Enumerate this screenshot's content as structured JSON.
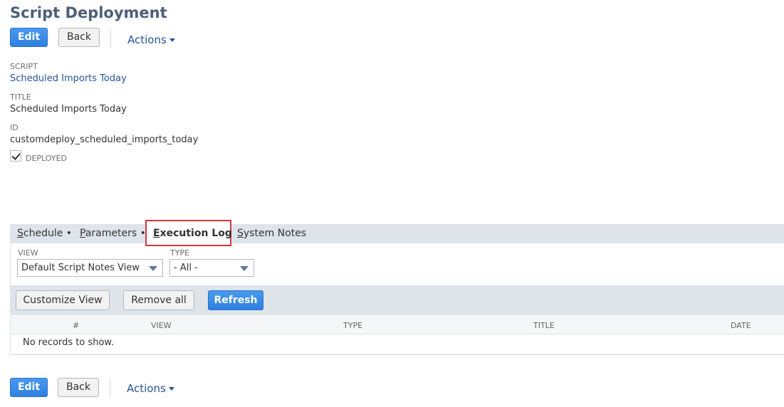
{
  "page": {
    "title": "Script Deployment"
  },
  "toolbar": {
    "edit_label": "Edit",
    "back_label": "Back",
    "actions_label": "Actions"
  },
  "fields": {
    "script_label": "Script",
    "script_value": "Scheduled Imports Today",
    "title_label": "Title",
    "title_value": "Scheduled Imports Today",
    "id_label": "ID",
    "id_value": "customdeploy_scheduled_imports_today",
    "deployed_label": "Deployed",
    "deployed_checked": true
  },
  "tabs": [
    {
      "first": "S",
      "rest": "chedule",
      "dot": " •"
    },
    {
      "first": "P",
      "rest": "arameters",
      "dot": " •"
    },
    {
      "first": "E",
      "rest": "xecution Log",
      "dot": ""
    },
    {
      "first": "S",
      "rest": "ystem Notes",
      "dot": ""
    }
  ],
  "active_tab": "Execution Log",
  "filters": {
    "view_label": "View",
    "view_value": "Default Script Notes View",
    "type_label": "Type",
    "type_value": "- All -"
  },
  "list_toolbar": {
    "customize_label": "Customize View",
    "remove_label": "Remove all",
    "refresh_label": "Refresh"
  },
  "table": {
    "columns": [
      "#",
      "View",
      "Type",
      "Title",
      "Date"
    ],
    "empty_message": "No records to show."
  },
  "colors": {
    "primary_button": "#3a8ee8",
    "link": "#255599",
    "title": "#4d5f79",
    "tab_bar": "#dfe4eb",
    "highlight": "#d9353a"
  }
}
